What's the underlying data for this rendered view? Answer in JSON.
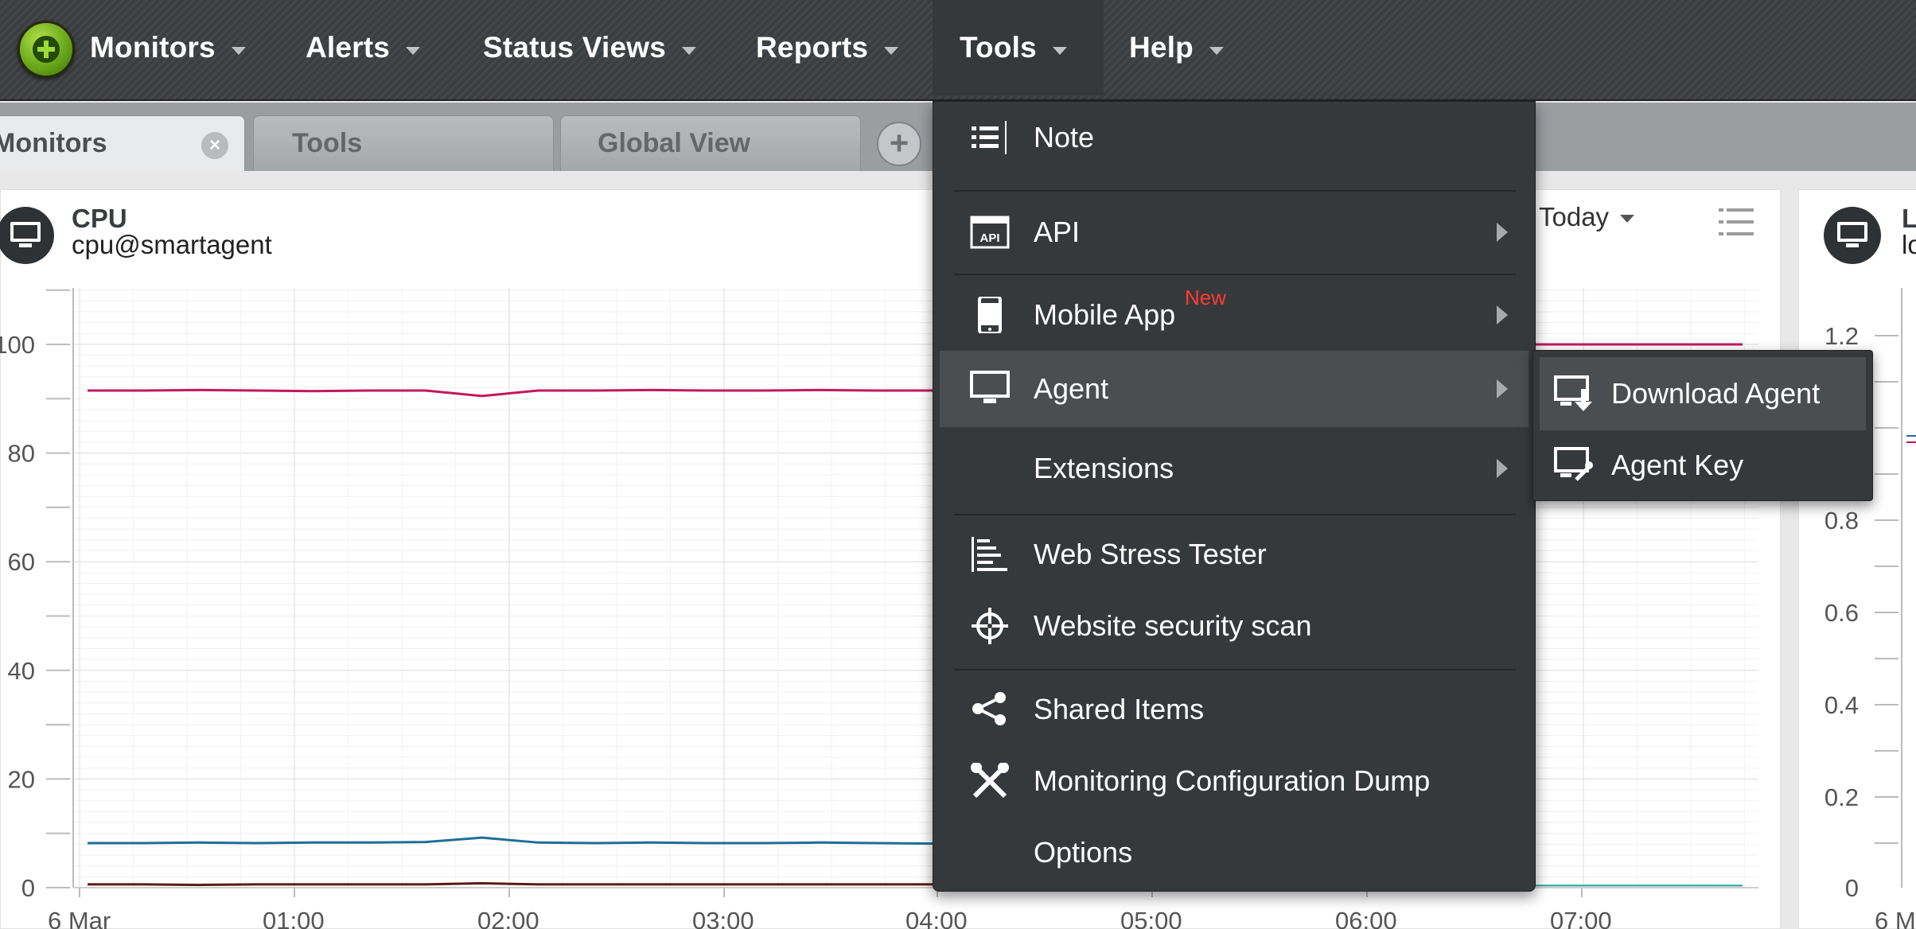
{
  "nav": {
    "items": [
      {
        "label": "Monitors"
      },
      {
        "label": "Alerts"
      },
      {
        "label": "Status Views"
      },
      {
        "label": "Reports"
      },
      {
        "label": "Tools"
      },
      {
        "label": "Help"
      }
    ],
    "active": "Tools"
  },
  "tabs": [
    {
      "label": "Monitors",
      "active": true
    },
    {
      "label": "Tools",
      "active": false
    },
    {
      "label": "Global View",
      "active": false
    }
  ],
  "widget": {
    "title": "CPU",
    "subtitle": "cpu@smartagent",
    "period": "Today"
  },
  "widget2": {
    "title_fragment": "L",
    "subtitle_fragment": "lo"
  },
  "tools_menu": {
    "items": [
      {
        "label": "Note",
        "icon": "list-icon"
      },
      {
        "label": "API",
        "icon": "api-icon",
        "submenu": true
      },
      {
        "label": "Mobile App",
        "icon": "mobile-icon",
        "submenu": true,
        "badge": "New"
      },
      {
        "label": "Agent",
        "icon": "monitor-icon",
        "submenu": true,
        "highlighted": true
      },
      {
        "label": "Extensions",
        "icon": "",
        "submenu": true
      },
      {
        "label": "Web Stress Tester",
        "icon": "stress-icon"
      },
      {
        "label": "Website security scan",
        "icon": "crosshair-icon"
      },
      {
        "label": "Shared Items",
        "icon": "share-icon"
      },
      {
        "label": "Monitoring Configuration Dump",
        "icon": "tools-icon"
      },
      {
        "label": "Options",
        "icon": ""
      }
    ]
  },
  "agent_submenu": {
    "items": [
      {
        "label": "Download Agent",
        "icon": "download-agent-icon",
        "highlighted": true
      },
      {
        "label": "Agent Key",
        "icon": "agent-key-icon"
      }
    ]
  },
  "colors": {
    "series_total": "#c2185b",
    "series_system": "#1f6e99",
    "series_user": "#5b1a14",
    "series_other": "#19a7a0",
    "menu_bg": "#36393c",
    "new_badge": "#ff3b30"
  },
  "chart_data": [
    {
      "type": "line",
      "title": "CPU",
      "subtitle": "cpu@smartagent",
      "x_tick_labels": [
        "6 Mar",
        "01:00",
        "02:00",
        "03:00",
        "04:00",
        "05:00",
        "06:00",
        "07:00"
      ],
      "y_tick_labels": [
        "0",
        "20",
        "40",
        "60",
        "80",
        "100"
      ],
      "ylim": [
        0,
        110
      ],
      "grid": true,
      "series": [
        {
          "values": [
            91.5,
            91.5,
            91.6,
            91.5,
            91.4,
            91.5,
            91.5,
            90.5,
            91.5,
            91.5,
            91.6,
            91.5,
            91.5,
            91.6,
            91.5,
            91.5
          ]
        },
        {
          "values": [
            8.2,
            8.2,
            8.3,
            8.2,
            8.3,
            8.3,
            8.4,
            9.2,
            8.3,
            8.2,
            8.3,
            8.2,
            8.2,
            8.3,
            8.2,
            8.1
          ]
        },
        {
          "values": [
            0.6,
            0.6,
            0.5,
            0.6,
            0.6,
            0.6,
            0.6,
            0.8,
            0.6,
            0.6,
            0.6,
            0.6,
            0.6,
            0.6,
            0.6,
            0.6
          ]
        }
      ],
      "visible_right_tail": {
        "total": 100,
        "other": 0.1
      }
    },
    {
      "type": "line",
      "y_tick_labels": [
        "0",
        "0.2",
        "0.4",
        "0.6",
        "0.8",
        "1.2"
      ],
      "x_tick_labels": [
        "6 M"
      ]
    }
  ]
}
